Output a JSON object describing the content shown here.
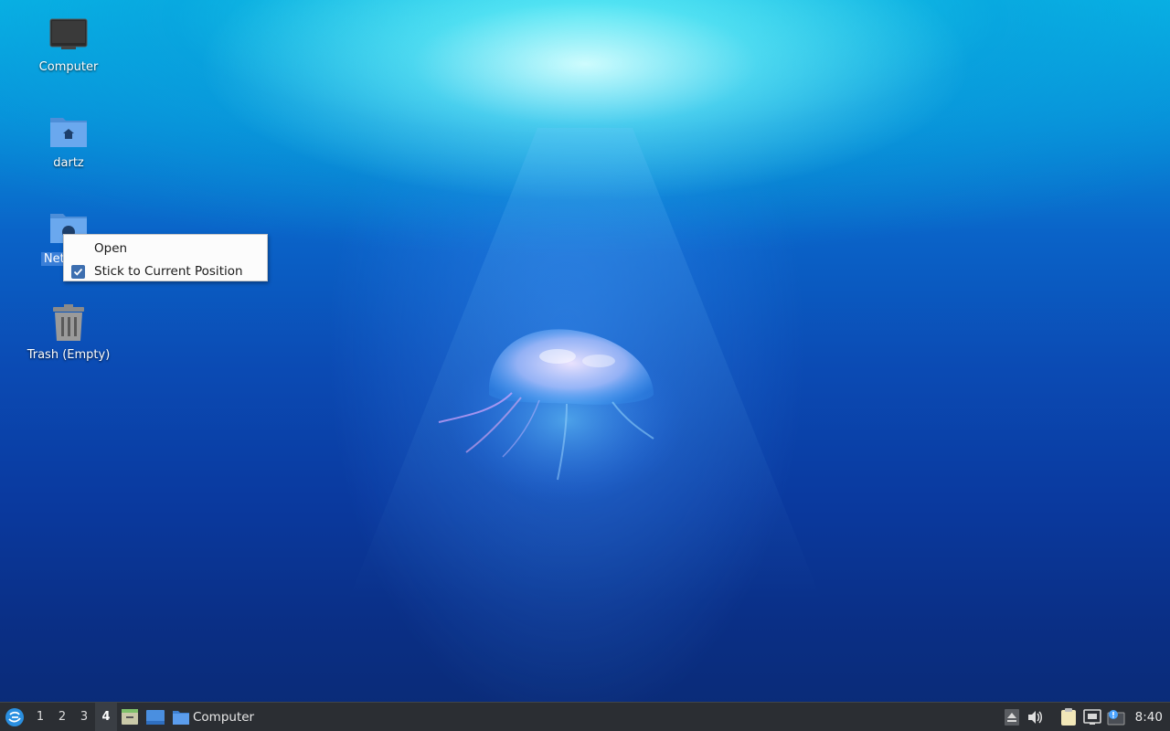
{
  "desktop": {
    "icons": [
      {
        "label": "Computer"
      },
      {
        "label": "dartz"
      },
      {
        "label": "Network"
      },
      {
        "label": "Trash (Empty)"
      }
    ]
  },
  "context_menu": {
    "items": [
      {
        "label": "Open",
        "checked": false
      },
      {
        "label": "Stick to Current Position",
        "checked": true
      }
    ]
  },
  "taskbar": {
    "start_icon": "lxqt-menu-icon",
    "workspaces": [
      "1",
      "2",
      "3",
      "4"
    ],
    "active_workspace": "4",
    "quicklaunch": [
      "file-manager-icon",
      "show-desktop-icon"
    ],
    "tasks": [
      {
        "label": "Computer",
        "icon": "folder-icon"
      }
    ],
    "tray": [
      "eject-icon",
      "volume-icon",
      "clipboard-icon",
      "network-icon",
      "notification-icon"
    ],
    "clock": "8:40"
  },
  "colors": {
    "taskbar_bg": "#2b2e33",
    "selection": "#3a7fd8",
    "check": "#3d6fb0"
  }
}
